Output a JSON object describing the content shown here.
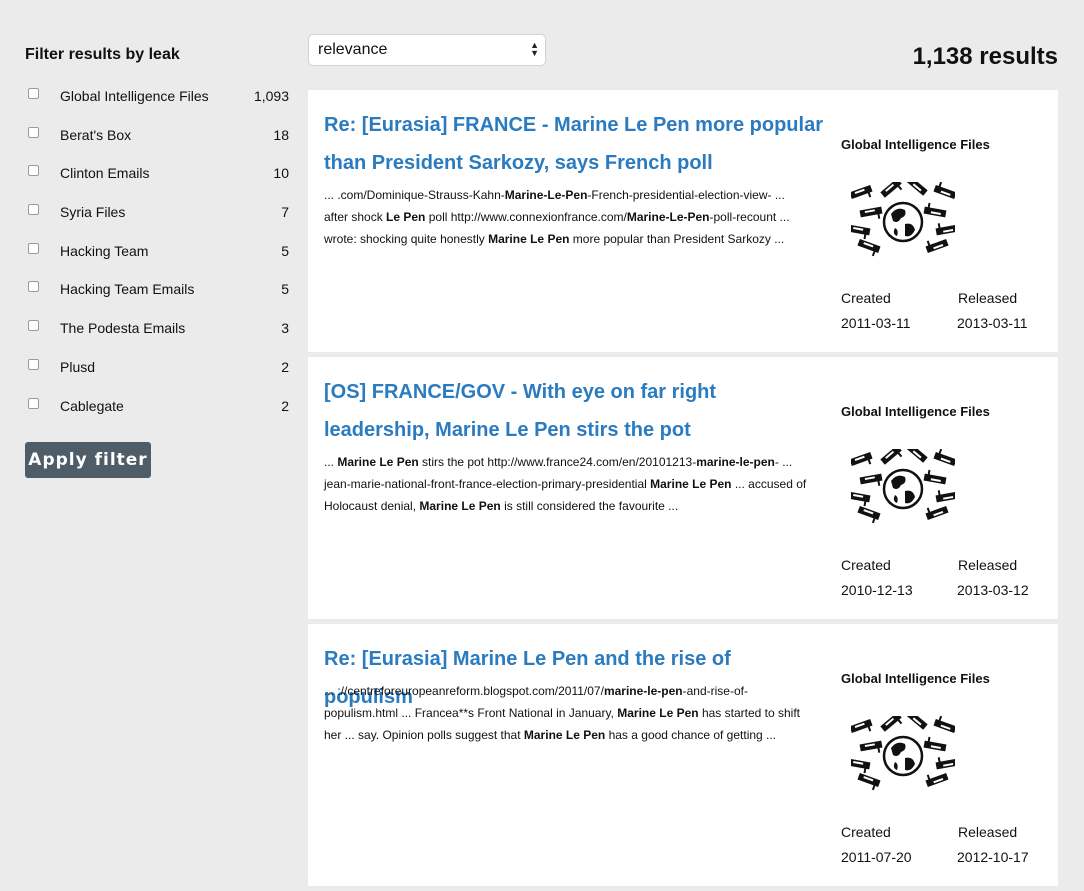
{
  "sidebar": {
    "title": "Filter results by leak",
    "filters": [
      {
        "label": "Global Intelligence Files",
        "count": "1,093"
      },
      {
        "label": "Berat's Box",
        "count": "18"
      },
      {
        "label": "Clinton Emails",
        "count": "10"
      },
      {
        "label": "Syria Files",
        "count": "7"
      },
      {
        "label": "Hacking Team",
        "count": "5"
      },
      {
        "label": "Hacking Team Emails",
        "count": "5"
      },
      {
        "label": "The Podesta Emails",
        "count": "3"
      },
      {
        "label": "Plusd",
        "count": "2"
      },
      {
        "label": "Cablegate",
        "count": "2"
      }
    ],
    "apply_label": "Apply filter"
  },
  "toolbar": {
    "sort_value": "relevance",
    "results_count": "1,138 results"
  },
  "meta_labels": {
    "created": "Created",
    "released": "Released"
  },
  "results": [
    {
      "title": "Re: [Eurasia] FRANCE - Marine Le Pen more popular than President Sarkozy, says French poll",
      "snippet": [
        [
          {
            "t": "... .com/Dominique-Strauss-Kahn-"
          },
          {
            "t": "Marine-Le-Pen",
            "b": true
          },
          {
            "t": "-French-presidential-election-view- ..."
          }
        ],
        [
          {
            "t": "after shock "
          },
          {
            "t": "Le Pen",
            "b": true
          },
          {
            "t": " poll http://www.connexionfrance.com/"
          },
          {
            "t": "Marine-Le-Pen",
            "b": true
          },
          {
            "t": "-poll-recount ..."
          }
        ],
        [
          {
            "t": "wrote: shocking quite honestly "
          },
          {
            "t": "Marine Le Pen",
            "b": true
          },
          {
            "t": " more popular than President Sarkozy ..."
          }
        ]
      ],
      "leak": "Global Intelligence Files",
      "created": "2011-03-11",
      "released": "2013-03-11"
    },
    {
      "title": "[OS] FRANCE/GOV - With eye on far right leadership, Marine Le Pen stirs the pot",
      "snippet": [
        [
          {
            "t": "... "
          },
          {
            "t": "Marine Le Pen",
            "b": true
          },
          {
            "t": " stirs the pot http://www.france24.com/en/20101213-"
          },
          {
            "t": "marine-le-pen",
            "b": true
          },
          {
            "t": "- ..."
          }
        ],
        [
          {
            "t": "jean-marie-national-front-france-election-primary-presidential "
          },
          {
            "t": "Marine Le Pen",
            "b": true
          },
          {
            "t": " ... accused of"
          }
        ],
        [
          {
            "t": "Holocaust denial, "
          },
          {
            "t": "Marine Le Pen",
            "b": true
          },
          {
            "t": " is still considered the favourite ..."
          }
        ]
      ],
      "leak": "Global Intelligence Files",
      "created": "2010-12-13",
      "released": "2013-03-12"
    },
    {
      "title": "Re: [Eurasia] Marine Le Pen and the rise of populism",
      "snippet": [
        [
          {
            "t": "... ://centreforeuropeanreform.blogspot.com/2011/07/"
          },
          {
            "t": "marine-le-pen",
            "b": true
          },
          {
            "t": "-and-rise-of-"
          }
        ],
        [
          {
            "t": "populism.html ... Francea**s Front National in January, "
          },
          {
            "t": "Marine Le Pen",
            "b": true
          },
          {
            "t": " has started to shift"
          }
        ],
        [
          {
            "t": "her ... say. Opinion polls suggest that "
          },
          {
            "t": "Marine Le Pen",
            "b": true
          },
          {
            "t": " has a good chance of getting ..."
          }
        ]
      ],
      "leak": "Global Intelligence Files",
      "created": "2011-07-20",
      "released": "2012-10-17"
    }
  ]
}
